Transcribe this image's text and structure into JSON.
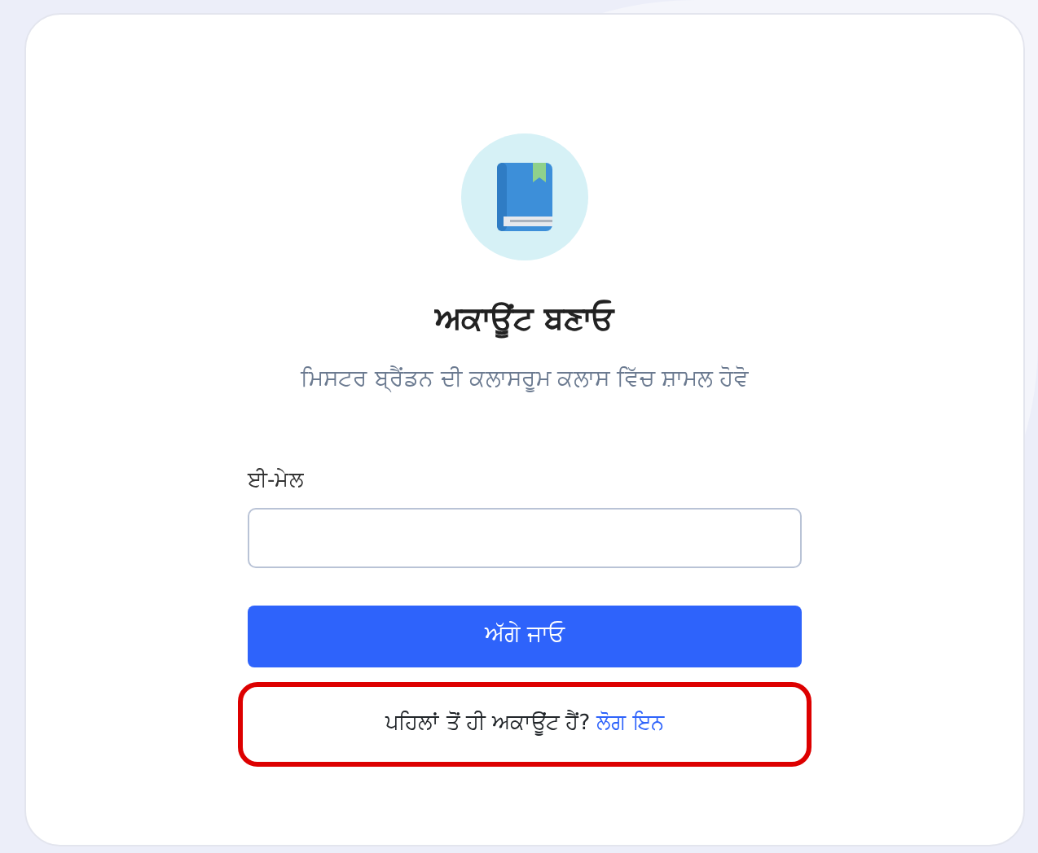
{
  "title": "ਅਕਾਊਂਟ ਬਣਾਓ",
  "subtitle": "ਮਿਸਟਰ ਬ੍ਰੈਂਡਨ ਦੀ ਕਲਾਸਰੂਮ ਕਲਾਸ ਵਿੱਚ ਸ਼ਾਮਲ ਹੋਵੋ",
  "email": {
    "label": "ਈ-ਮੇਲ"
  },
  "submit_button": "ਅੱਗੇ ਜਾਓ",
  "login_prompt": {
    "text": "ਪਹਿਲਾਂ ਤੋਂ ਹੀ ਅਕਾਊਂਟ ਹੈਂ?",
    "link": "ਲੋਗ ਇਨ",
    "highlighted": true
  }
}
